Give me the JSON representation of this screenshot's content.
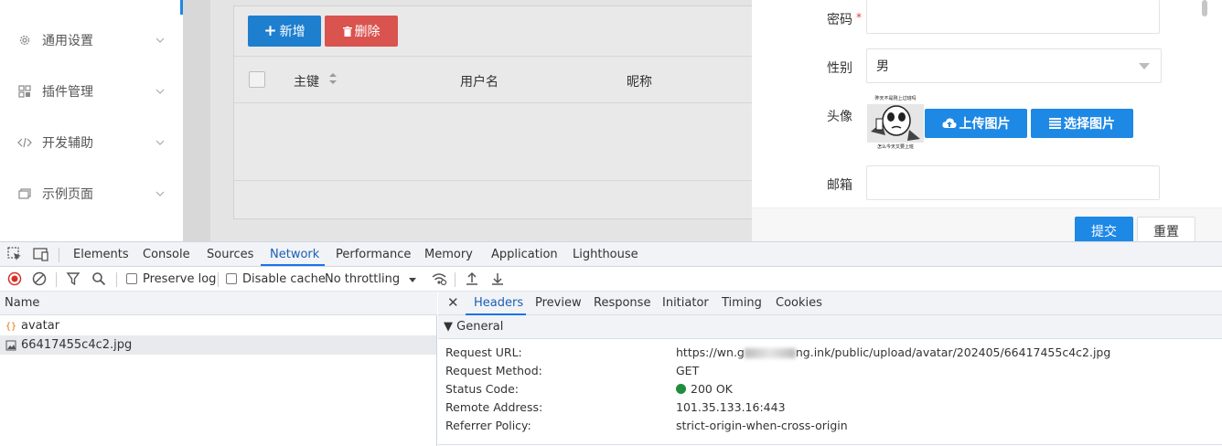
{
  "sidebar": {
    "items": [
      {
        "label": "通用设置",
        "icon": "gear-icon"
      },
      {
        "label": "插件管理",
        "icon": "grid-icon"
      },
      {
        "label": "开发辅助",
        "icon": "code-icon"
      },
      {
        "label": "示例页面",
        "icon": "page-icon"
      }
    ]
  },
  "toolbar": {
    "add_label": "新增",
    "delete_label": "删除"
  },
  "table": {
    "columns": [
      "主键",
      "用户名",
      "昵称"
    ]
  },
  "form": {
    "password_label": "密码",
    "required_mark": "*",
    "gender_label": "性别",
    "gender_value": "男",
    "avatar_label": "头像",
    "upload_label": "上传图片",
    "choose_label": "选择图片",
    "email_label": "邮箱",
    "submit_label": "提交",
    "reset_label": "重置",
    "avatar_caption_top": "昨天不是刚上过班吗",
    "avatar_caption_bottom": "怎么今天又要上班"
  },
  "devtools": {
    "tabs": [
      "Elements",
      "Console",
      "Sources",
      "Network",
      "Performance",
      "Memory",
      "Application",
      "Lighthouse"
    ],
    "active_tab": "Network",
    "network_toolbar": {
      "preserve_log": "Preserve log",
      "disable_cache": "Disable cache",
      "throttling": "No throttling"
    },
    "request_list": {
      "header": "Name",
      "rows": [
        "avatar",
        "66417455c4c2.jpg"
      ]
    },
    "detail_tabs": [
      "Headers",
      "Preview",
      "Response",
      "Initiator",
      "Timing",
      "Cookies"
    ],
    "active_detail_tab": "Headers",
    "general": {
      "title": "▼ General",
      "rows": [
        {
          "label": "Request URL:",
          "value_prefix": "https://wn.g",
          "value_mid": "ng.ink/public/upload/avatar/202405/66417455c4c2.jpg"
        },
        {
          "label": "Request Method:",
          "value": "GET"
        },
        {
          "label": "Status Code:",
          "value": "200 OK"
        },
        {
          "label": "Remote Address:",
          "value": "101.35.133.16:443"
        },
        {
          "label": "Referrer Policy:",
          "value": "strict-origin-when-cross-origin"
        }
      ]
    }
  },
  "colors": {
    "primary": "#1e88e5",
    "danger": "#d9534f",
    "devtools_accent": "#1a73e8",
    "status_ok": "#1e8e3e"
  }
}
